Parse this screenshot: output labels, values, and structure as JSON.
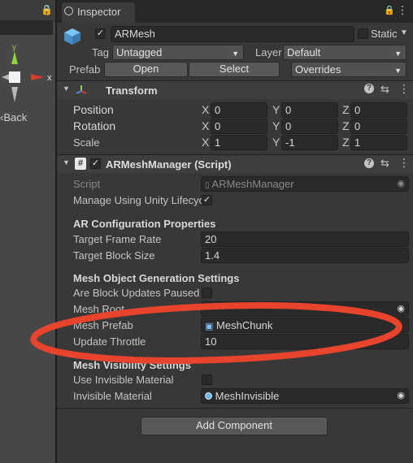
{
  "scene": {
    "gizmo_y": "y",
    "gizmo_x": "x",
    "back_label": "Back"
  },
  "inspector": {
    "tab_label": "Inspector",
    "object_name": "ARMesh",
    "static_label": "Static",
    "tag_label": "Tag",
    "tag_value": "Untagged",
    "layer_label": "Layer",
    "layer_value": "Default",
    "prefab_label": "Prefab",
    "open_label": "Open",
    "select_label": "Select",
    "overrides_label": "Overrides"
  },
  "transform": {
    "title": "Transform",
    "position_label": "Position",
    "rotation_label": "Rotation",
    "scale_label": "Scale",
    "axes": [
      "X",
      "Y",
      "Z"
    ],
    "position": [
      "0",
      "0",
      "0"
    ],
    "rotation": [
      "0",
      "0",
      "0"
    ],
    "scale": [
      "1",
      "-1",
      "1"
    ]
  },
  "manager": {
    "title": "ARMeshManager (Script)",
    "script_label": "Script",
    "script_value": "ARMeshManager",
    "manage_label": "Manage Using Unity Lifecyc",
    "ar_config_header": "AR Configuration Properties",
    "frame_rate_label": "Target Frame Rate",
    "frame_rate_value": "20",
    "block_size_label": "Target Block Size",
    "block_size_value": "1.4",
    "mesh_gen_header": "Mesh Object Generation Settings",
    "block_paused_label": "Are Block Updates Paused",
    "mesh_root_label": "Mesh Root",
    "mesh_prefab_label": "Mesh Prefab",
    "mesh_prefab_value": "MeshChunk",
    "throttle_label": "Update Throttle",
    "throttle_value": "10",
    "visibility_header": "Mesh Visibility Settings",
    "use_invisible_label": "Use Invisible Material",
    "invisible_material_label": "Invisible Material",
    "invisible_material_value": "MeshInvisible"
  },
  "add_component_label": "Add Component",
  "colors": {
    "annotation": "#e8432c",
    "gizmo_y": "#8fd23a",
    "gizmo_x": "#d8402c"
  }
}
